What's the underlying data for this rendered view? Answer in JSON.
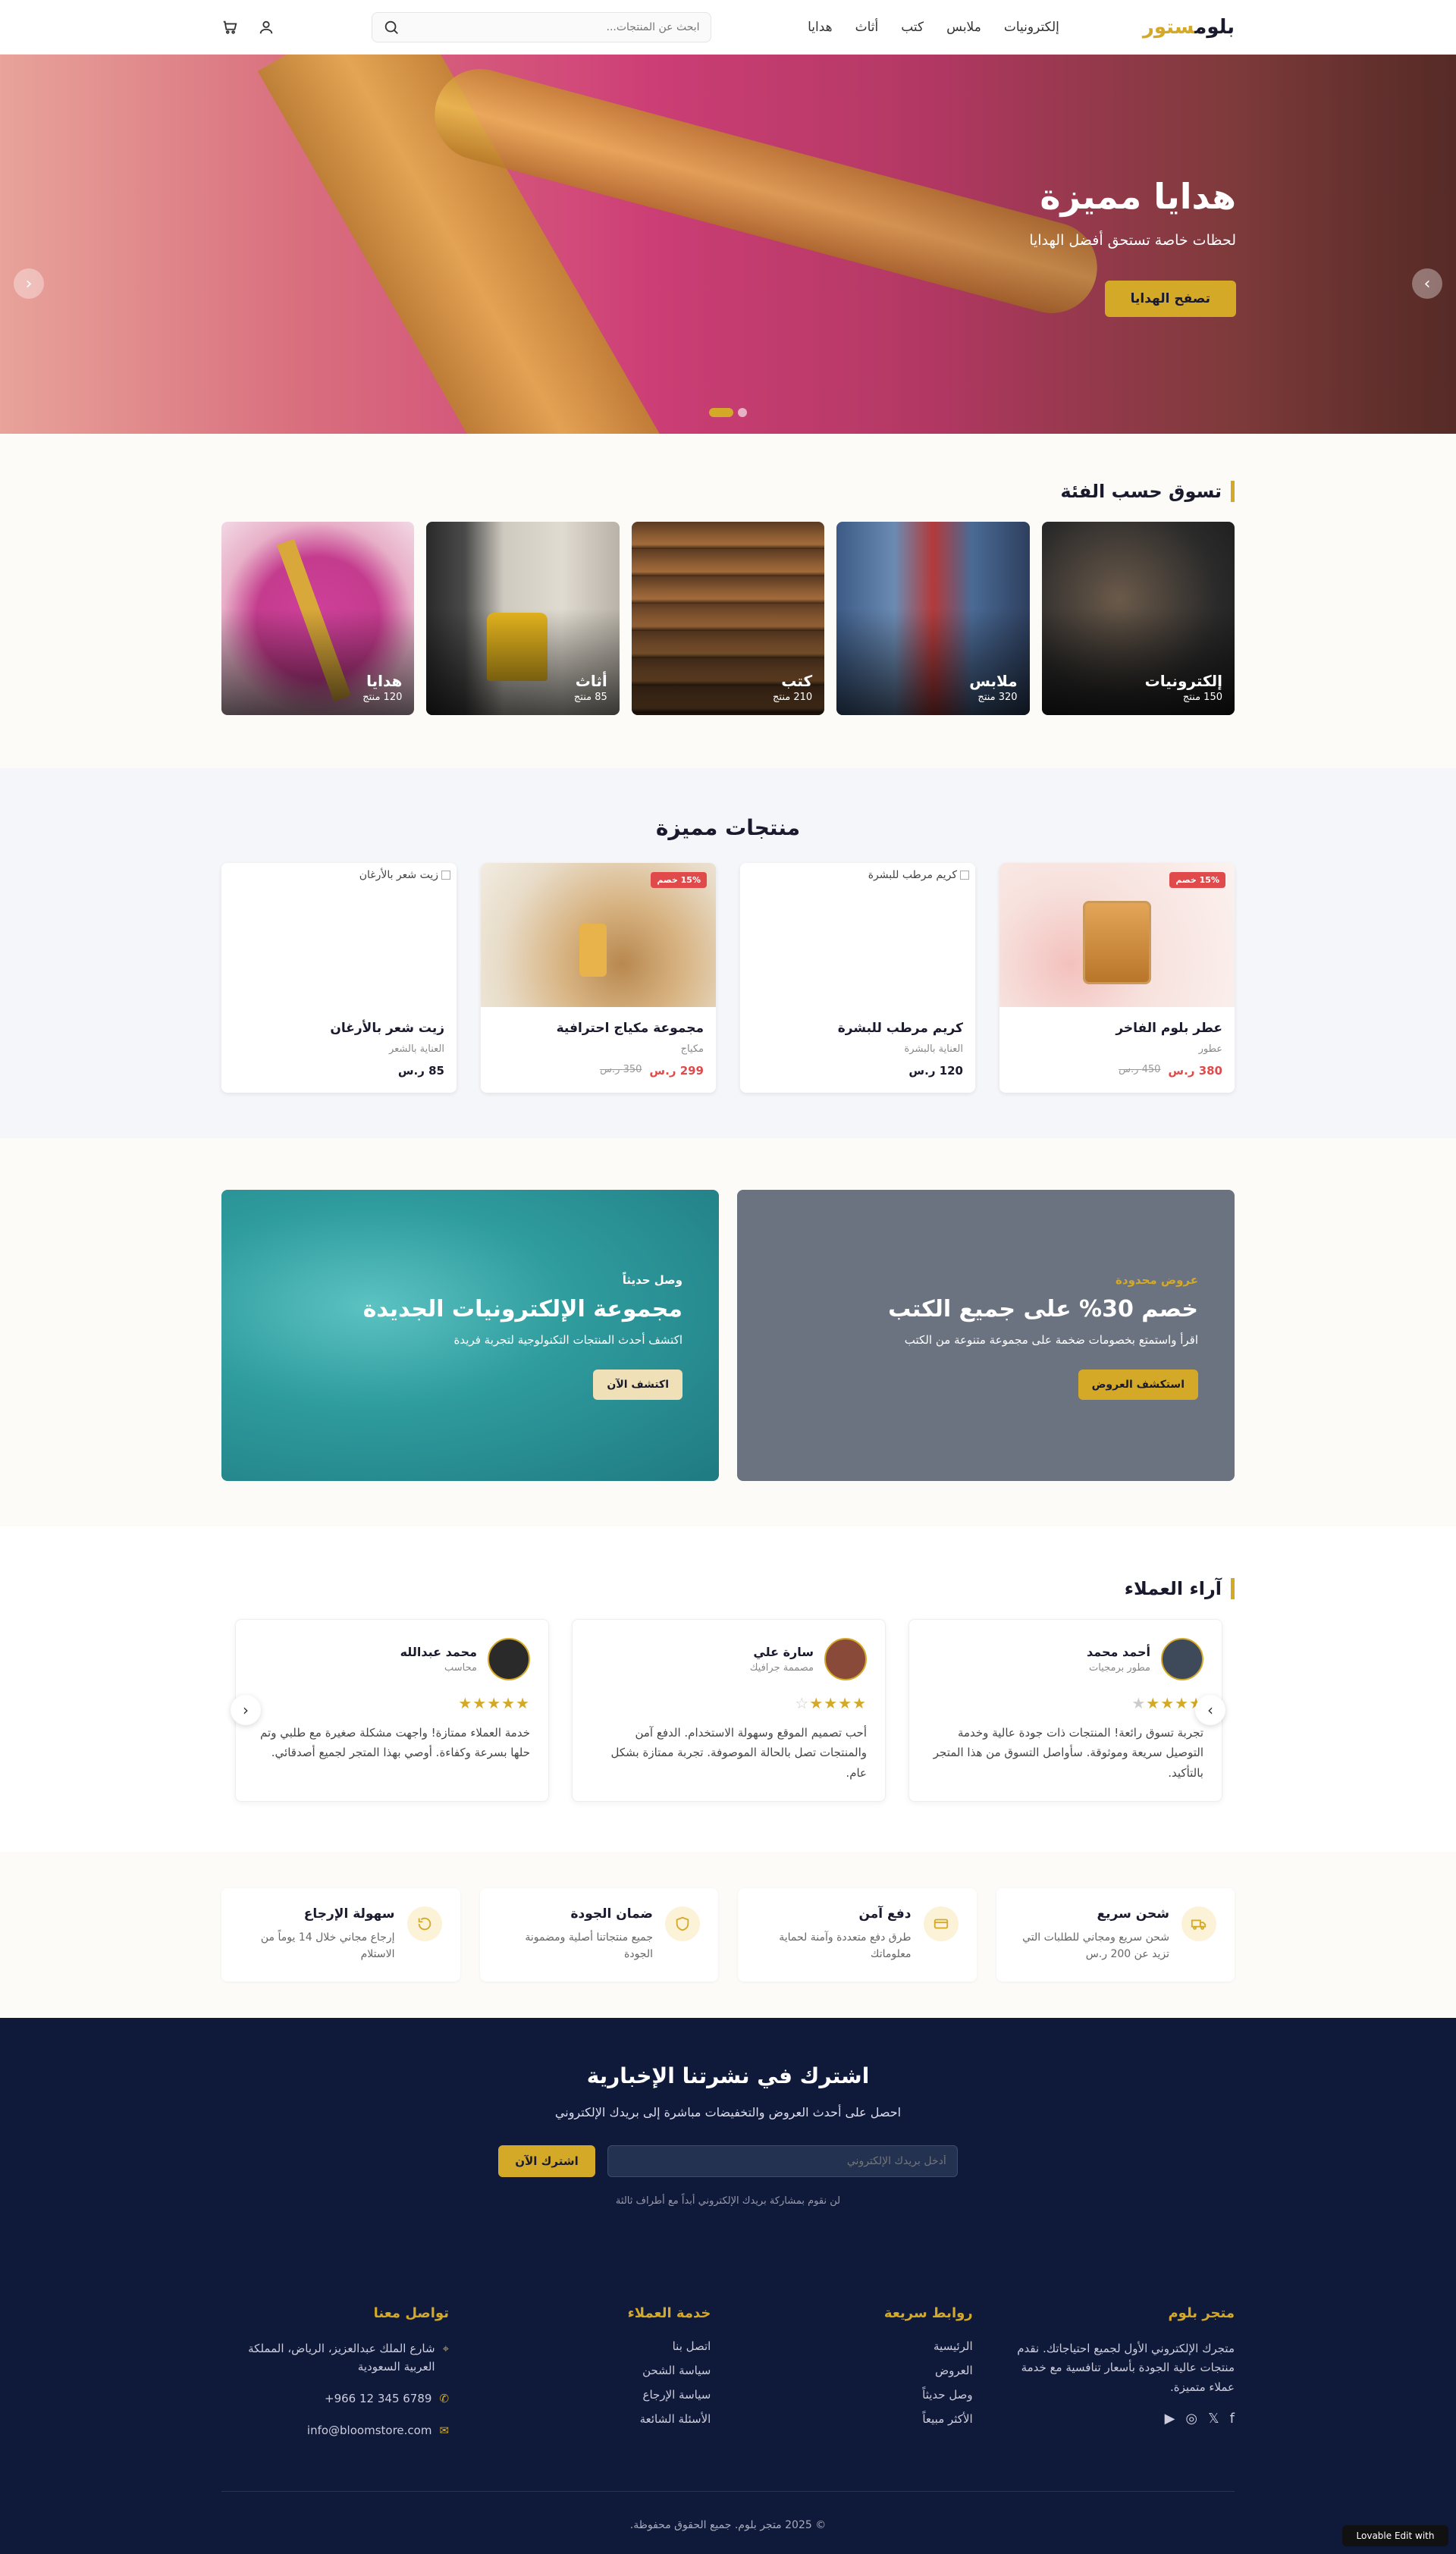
{
  "header": {
    "logo_main": "بلوم",
    "logo_accent": "ستور",
    "nav": [
      "إلكترونيات",
      "ملابس",
      "كتب",
      "أثاث",
      "هدايا"
    ],
    "search_placeholder": "ابحث عن المنتجات...",
    "icons": [
      "search-icon",
      "user-icon",
      "cart-icon"
    ]
  },
  "hero": {
    "title": "هدايا مميزة",
    "subtitle": "لحظات خاصة تستحق أفضل الهدايا",
    "button": "تصفح الهدايا",
    "slides": 2,
    "active_slide": 0,
    "prev_icon": "chevron-left-icon",
    "next_icon": "chevron-right-icon"
  },
  "categories": {
    "title": "تسوق حسب الفئة",
    "items": [
      {
        "name": "إلكترونيات",
        "count": "150 منتج"
      },
      {
        "name": "ملابس",
        "count": "320 منتج"
      },
      {
        "name": "كتب",
        "count": "210 منتج"
      },
      {
        "name": "أثاث",
        "count": "85 منتج"
      },
      {
        "name": "هدايا",
        "count": "120 منتج"
      }
    ]
  },
  "featured": {
    "title": "منتجات مميزة",
    "products": [
      {
        "name": "عطر بلوم الفاخر",
        "category": "عطور",
        "price": "380 ر.س",
        "old_price": "450 ر.س",
        "badge": "15% خصم",
        "image_alt": ""
      },
      {
        "name": "كريم مرطب للبشرة",
        "category": "العناية بالبشرة",
        "price": "120 ر.س",
        "old_price": "",
        "badge": "",
        "image_alt": "كريم مرطب للبشرة"
      },
      {
        "name": "مجموعة مكياج احترافية",
        "category": "مكياج",
        "price": "299 ر.س",
        "old_price": "350 ر.س",
        "badge": "15% خصم",
        "image_alt": ""
      },
      {
        "name": "زيت شعر بالأرغان",
        "category": "العناية بالشعر",
        "price": "85 ر.س",
        "old_price": "",
        "badge": "",
        "image_alt": "زيت شعر بالأرغان"
      }
    ]
  },
  "promos": [
    {
      "eyebrow": "عروض محدودة",
      "title": "خصم 30% على جميع الكتب",
      "subtitle": "اقرأ واستمتع بخصومات ضخمة على مجموعة متنوعة من الكتب",
      "button": "استكشف العروض"
    },
    {
      "eyebrow": "وصل حديثاً",
      "title": "مجموعة الإلكترونيات الجديدة",
      "subtitle": "اكتشف أحدث المنتجات التكنولوجية لتجربة فريدة",
      "button": "اكتشف الآن"
    }
  ],
  "testimonials": {
    "title": "آراء العملاء",
    "items": [
      {
        "name": "أحمد محمد",
        "role": "مطور برمجيات",
        "rating": 4,
        "text": "تجربة تسوق رائعة! المنتجات ذات جودة عالية وخدمة التوصيل سريعة وموثوقة. سأواصل التسوق من هذا المتجر بالتأكيد."
      },
      {
        "name": "سارة علي",
        "role": "مصممة جرافيك",
        "rating": 4,
        "text": "أحب تصميم الموقع وسهولة الاستخدام. الدفع آمن والمنتجات تصل بالحالة الموصوفة. تجربة ممتازة بشكل عام."
      },
      {
        "name": "محمد عبدالله",
        "role": "محاسب",
        "rating": 5,
        "text": "خدمة العملاء ممتازة! واجهت مشكلة صغيرة مع طلبي وتم حلها بسرعة وكفاءة. أوصي بهذا المتجر لجميع أصدقائي."
      }
    ]
  },
  "features": [
    {
      "title": "شحن سريع",
      "text": "شحن سريع ومجاني للطلبات التي تزيد عن 200 ر.س",
      "icon": "truck-icon"
    },
    {
      "title": "دفع آمن",
      "text": "طرق دفع متعددة وآمنة لحماية معلوماتك",
      "icon": "card-icon"
    },
    {
      "title": "ضمان الجودة",
      "text": "جميع منتجاتنا أصلية ومضمونة الجودة",
      "icon": "shield-icon"
    },
    {
      "title": "سهولة الإرجاع",
      "text": "إرجاع مجاني خلال 14 يوماً من الاستلام",
      "icon": "return-icon"
    }
  ],
  "newsletter": {
    "title": "اشترك في نشرتنا الإخبارية",
    "subtitle": "احصل على أحدث العروض والتخفيضات مباشرة إلى بريدك الإلكتروني",
    "placeholder": "أدخل بريدك الإلكتروني",
    "button": "اشترك الآن",
    "note": "لن نقوم بمشاركة بريدك الإلكتروني أبداً مع أطراف ثالثة"
  },
  "footer": {
    "about_title": "متجر بلوم",
    "about_text": "متجرك الإلكتروني الأول لجميع احتياجاتك. نقدم منتجات عالية الجودة بأسعار تنافسية مع خدمة عملاء متميزة.",
    "links_title": "روابط سريعة",
    "links": [
      "الرئيسية",
      "العروض",
      "وصل حديثاً",
      "الأكثر مبيعاً"
    ],
    "service_title": "خدمة العملاء",
    "service_links": [
      "اتصل بنا",
      "سياسة الشحن",
      "سياسة الإرجاع",
      "الأسئلة الشائعة"
    ],
    "contact_title": "تواصل معنا",
    "address": "شارع الملك عبدالعزيز، الرياض، المملكة العربية السعودية",
    "phone": "+966 12 345 6789",
    "email": "info@bloomstore.com",
    "copyright": "© 2025 متجر بلوم. جميع الحقوق محفوظة."
  },
  "edit_badge": "Lovable Edit with"
}
